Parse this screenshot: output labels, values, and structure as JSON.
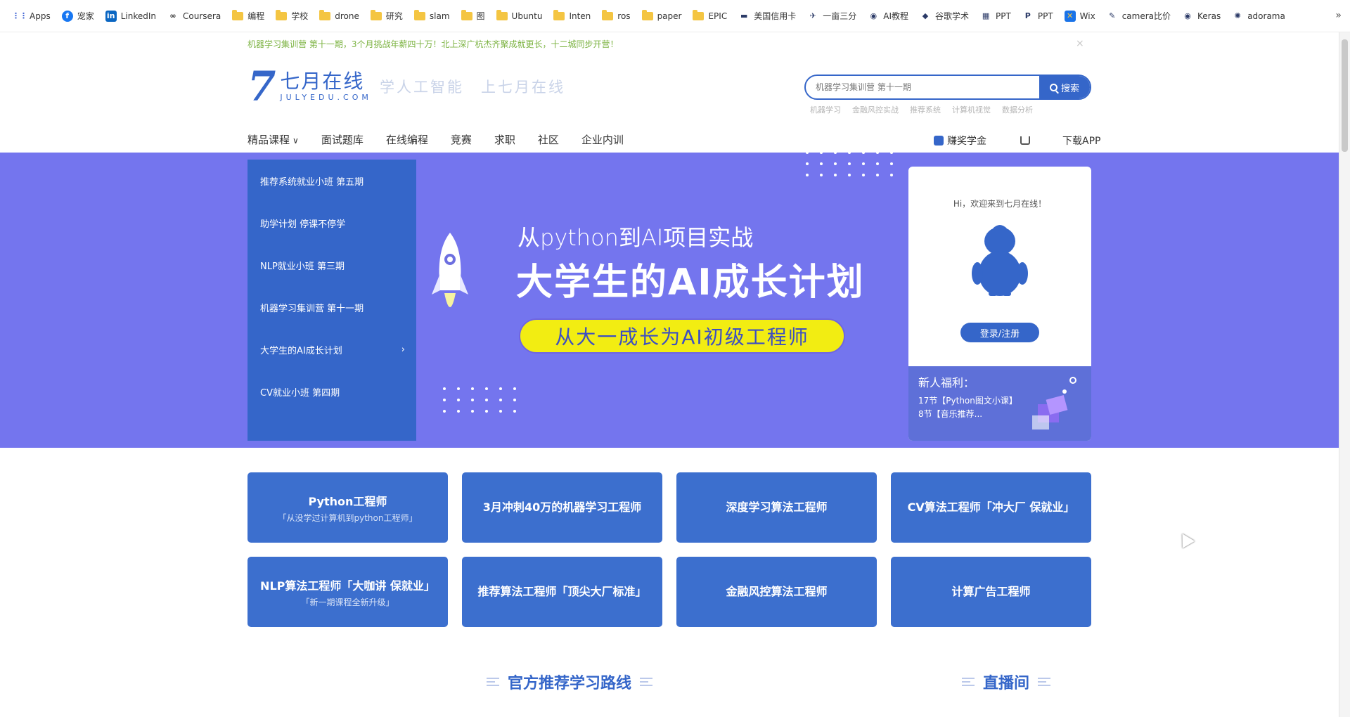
{
  "bookmarks": {
    "items": [
      {
        "label": "Apps",
        "icon": "apps-grid-icon",
        "color": "#4a6bd6"
      },
      {
        "label": "宠家",
        "icon": "facebook-icon",
        "color": "#1877f2"
      },
      {
        "label": "LinkedIn",
        "icon": "linkedin-icon",
        "color": "#0a66c2"
      },
      {
        "label": "Coursera",
        "icon": "coursera-icon",
        "color": "#333333"
      },
      {
        "label": "编程",
        "icon": "folder-icon",
        "color": "#f4c542"
      },
      {
        "label": "学校",
        "icon": "folder-icon",
        "color": "#f4c542"
      },
      {
        "label": "drone",
        "icon": "folder-icon",
        "color": "#f4c542"
      },
      {
        "label": "研究",
        "icon": "folder-icon",
        "color": "#f4c542"
      },
      {
        "label": "slam",
        "icon": "folder-icon",
        "color": "#f4c542"
      },
      {
        "label": "图",
        "icon": "folder-icon",
        "color": "#f4c542"
      },
      {
        "label": "Ubuntu",
        "icon": "folder-icon",
        "color": "#f4c542"
      },
      {
        "label": "Inten",
        "icon": "folder-icon",
        "color": "#f4c542"
      },
      {
        "label": "ros",
        "icon": "folder-icon",
        "color": "#f4c542"
      },
      {
        "label": "paper",
        "icon": "folder-icon",
        "color": "#f4c542"
      },
      {
        "label": "EPIC",
        "icon": "folder-icon",
        "color": "#f4c542"
      },
      {
        "label": "美国信用卡",
        "icon": "card-icon",
        "color": "#2b3a67"
      },
      {
        "label": "一亩三分",
        "icon": "bird-icon",
        "color": "#2b3a67"
      },
      {
        "label": "AI教程",
        "icon": "globe-icon",
        "color": "#2b3a67"
      },
      {
        "label": "谷歌学术",
        "icon": "scholar-icon",
        "color": "#2b3a67"
      },
      {
        "label": "PPT",
        "icon": "ppt-icon",
        "color": "#2b3a67"
      },
      {
        "label": "PPT",
        "icon": "ppt-p-icon",
        "color": "#2b3a67"
      },
      {
        "label": "Wix",
        "icon": "wix-icon",
        "color": "#1a73e8"
      },
      {
        "label": "camera比价",
        "icon": "camera-icon",
        "color": "#2b3a67"
      },
      {
        "label": "Keras",
        "icon": "globe-icon",
        "color": "#2b3a67"
      },
      {
        "label": "adorama",
        "icon": "gear-icon",
        "color": "#2b3a67"
      }
    ],
    "more": "»"
  },
  "announcement": "机器学习集训营 第十一期，3个月挑战年薪四十万！北上深广杭杰齐聚成就更长，十二城同步开营！",
  "announcement_close": "×",
  "header": {
    "logo_mark": "7",
    "logo_cn": "七月在线",
    "logo_en": "JULYEDU.COM",
    "slogan": "学人工智能　上七月在线",
    "search_placeholder": "机器学习集训营 第十一期",
    "search_button": "搜索",
    "hot_tags": [
      "机器学习",
      "金融风控实战",
      "推荐系统",
      "计算机视觉",
      "数据分析"
    ]
  },
  "nav": {
    "items": [
      "精品课程",
      "面试题库",
      "在线编程",
      "竞赛",
      "求职",
      "社区",
      "企业内训"
    ],
    "chevron": "∨",
    "bonus": "赚奖学金",
    "download": "下载APP"
  },
  "banner": {
    "menu": [
      {
        "label": "推荐系统就业小班 第五期",
        "arrow": ""
      },
      {
        "label": "助学计划 停课不停学",
        "arrow": ""
      },
      {
        "label": "NLP就业小班 第三期",
        "arrow": ""
      },
      {
        "label": "机器学习集训营 第十一期",
        "arrow": ""
      },
      {
        "label": "大学生的AI成长计划",
        "arrow": "›"
      },
      {
        "label": "CV就业小班 第四期",
        "arrow": ""
      }
    ],
    "subtitle": "从python到AI项目实战",
    "title": "大学生的AI成长计划",
    "pill": "从大一成长为AI初级工程师",
    "bg_color": "#7475ee",
    "pill_color": "#f2ed12"
  },
  "login_card": {
    "greeting": "Hi，欢迎来到七月在线！",
    "button": "登录/注册",
    "perk_title": "新人福利：",
    "perk_desc": "17节【Python图文小课】 8节【音乐推荐..."
  },
  "courses": [
    {
      "title": "Python工程师",
      "sub": "「从没学过计算机到python工程师」"
    },
    {
      "title": "3月冲刺40万的机器学习工程师",
      "sub": ""
    },
    {
      "title": "深度学习算法工程师",
      "sub": ""
    },
    {
      "title": "CV算法工程师「冲大厂 保就业」",
      "sub": ""
    },
    {
      "title": "NLP算法工程师「大咖讲 保就业」",
      "sub": "「新一期课程全新升级」"
    },
    {
      "title": "推荐算法工程师「顶尖大厂标准」",
      "sub": ""
    },
    {
      "title": "金融风控算法工程师",
      "sub": ""
    },
    {
      "title": "计算广告工程师",
      "sub": ""
    }
  ],
  "sections": {
    "left": "官方推荐学习路线",
    "right": "直播间"
  },
  "colors": {
    "brand": "#3566c9",
    "card": "#3c6fce"
  }
}
